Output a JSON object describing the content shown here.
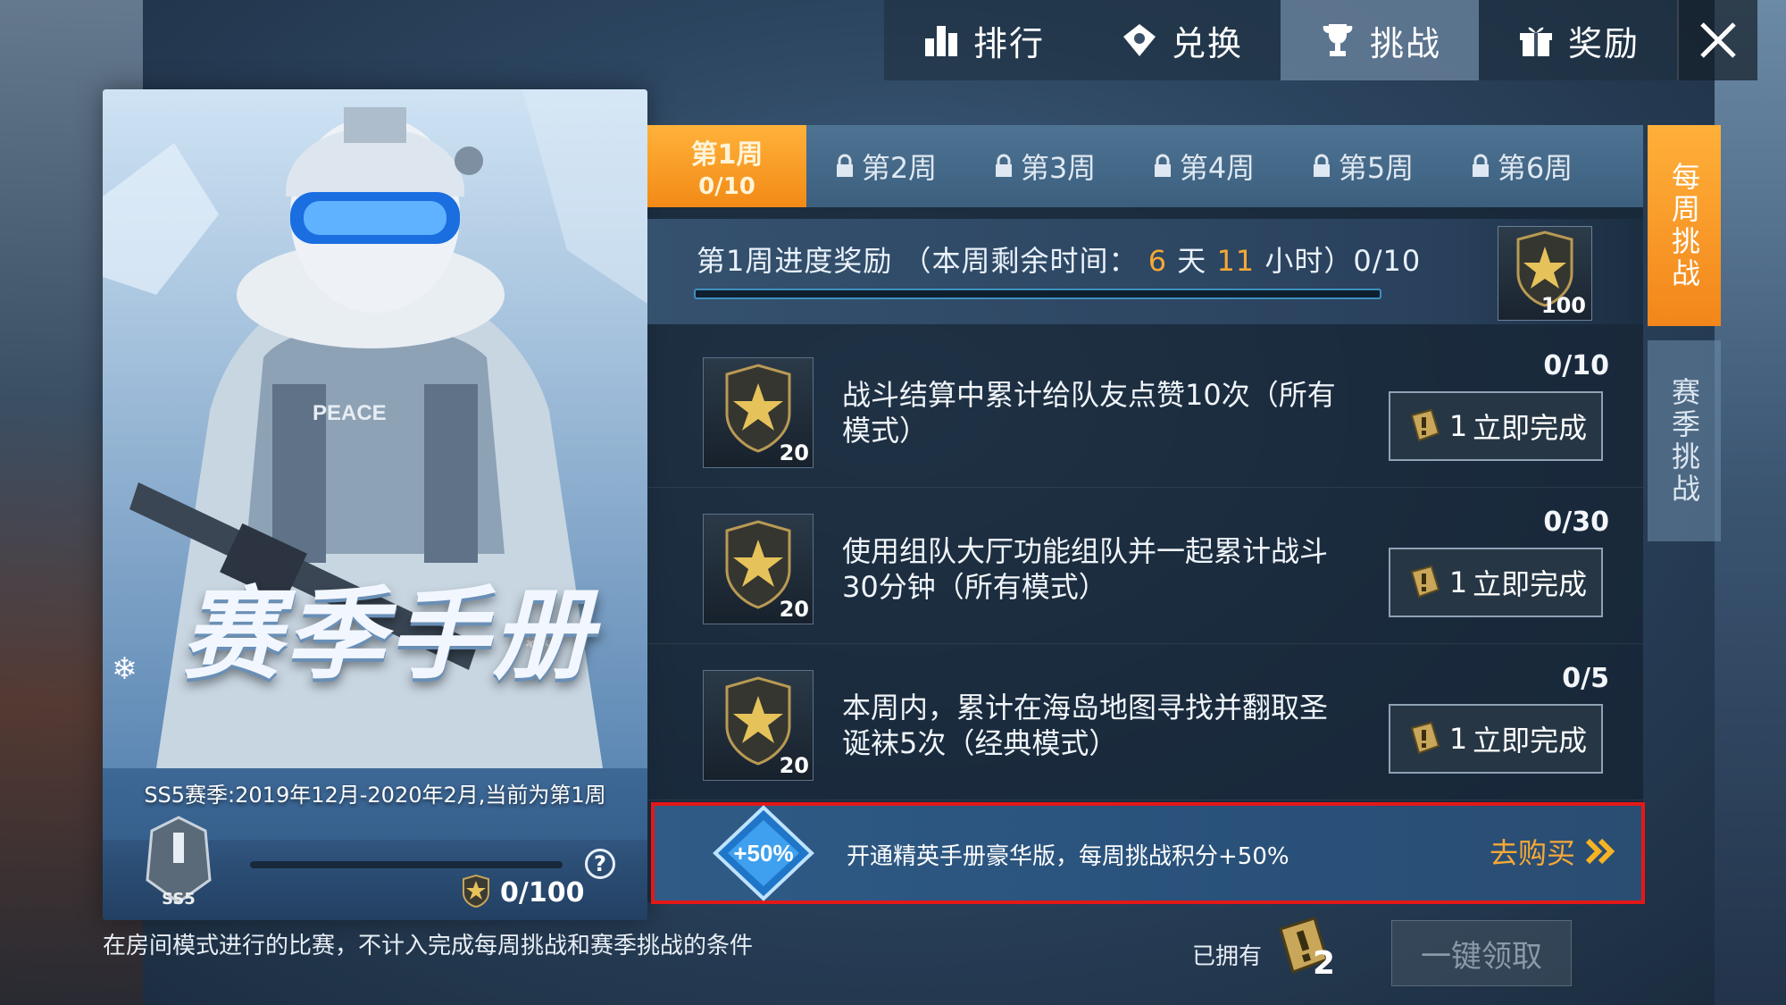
{
  "nav": {
    "tabs": [
      {
        "label": "排行",
        "icon": "ranking-icon"
      },
      {
        "label": "兑换",
        "icon": "exchange-icon"
      },
      {
        "label": "挑战",
        "icon": "trophy-icon",
        "active": true
      },
      {
        "label": "奖励",
        "icon": "gift-icon"
      }
    ],
    "close_icon": "close-icon"
  },
  "poster": {
    "title": "赛季手册",
    "subtitle": "SS5赛季:2019年12月-2020年2月,当前为第1周",
    "badge_label": "SS5",
    "help_glyph": "?",
    "season_progress": "0/100",
    "season_progress_value": 0,
    "armor_text": "PEACE"
  },
  "weeks": [
    {
      "label": "第1周",
      "progress": "0/10",
      "active": true,
      "locked": false
    },
    {
      "label": "第2周",
      "locked": true
    },
    {
      "label": "第3周",
      "locked": true
    },
    {
      "label": "第4周",
      "locked": true
    },
    {
      "label": "第5周",
      "locked": true
    },
    {
      "label": "第6周",
      "locked": true
    }
  ],
  "progress_reward": {
    "prefix": "第1周进度奖励 （本周剩余时间：",
    "days": "6",
    "days_unit": "天",
    "hours": "11",
    "hours_unit": "小时）",
    "progress": "0/10",
    "progress_value": 0,
    "reward_amount": "100"
  },
  "tasks": [
    {
      "desc": "战斗结算中累计给队友点赞10次（所有模式）",
      "progress": "0/10",
      "points": "20",
      "button": "立即完成",
      "button_count": "1"
    },
    {
      "desc": "使用组队大厅功能组队并一起累计战斗30分钟（所有模式）",
      "progress": "0/30",
      "points": "20",
      "button": "立即完成",
      "button_count": "1"
    },
    {
      "desc": "本周内，累计在海岛地图寻找并翻取圣诞袜5次（经典模式）",
      "progress": "0/5",
      "points": "20",
      "button": "立即完成",
      "button_count": "1"
    }
  ],
  "promo": {
    "badge": "+50%",
    "text": "开通精英手册豪华版，每周挑战积分+50%",
    "buy": "去购买"
  },
  "side_tabs": [
    {
      "label": "每周挑战",
      "active": true
    },
    {
      "label": "赛季挑战",
      "active": false
    }
  ],
  "footer": {
    "note": "在房间模式进行的比赛，不计入完成每周挑战和赛季挑战的条件",
    "owned_label": "已拥有",
    "owned_count": "2",
    "claim_all": "一键领取"
  },
  "colors": {
    "accent_orange": "#f28a16",
    "highlight": "#f6a836",
    "promo_border": "#e41818"
  }
}
